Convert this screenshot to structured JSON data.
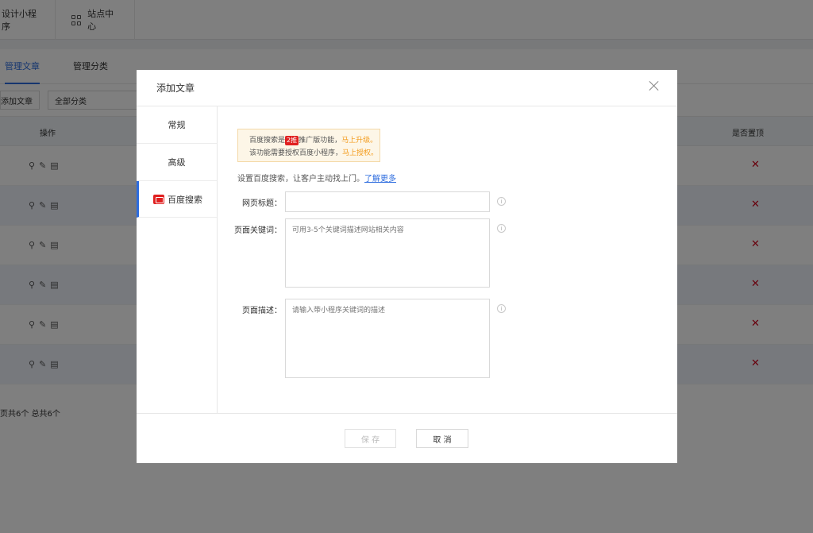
{
  "topbar": {
    "item1": "设计小程序",
    "item2": "站点中心"
  },
  "tabs": [
    "管理文章",
    "管理分类"
  ],
  "toolbar": {
    "add_label": "添加文章",
    "category_select": "全部分类"
  },
  "table": {
    "col_ops": "操作",
    "col_top": "是否置顶",
    "rows": 6,
    "x_mark": "✕"
  },
  "footer": "页共6个  总共6个",
  "modal": {
    "title": "添加文章",
    "side": {
      "item1": "常规",
      "item2": "高级",
      "item3": "百度搜索"
    },
    "notice": {
      "line1_a": "百度搜索是",
      "tag": "2推",
      "line1_b": "推广版功能，",
      "line1_link": "马上升级。",
      "line2_a": "该功能需要授权百度小程序，",
      "line2_link": "马上授权。"
    },
    "intro": "设置百度搜索，让客户主动找上门。",
    "intro_link": "了解更多",
    "fields": {
      "title_label": "网页标题：",
      "keywords_label": "页面关键词：",
      "keywords_placeholder": "可用3-5个关键词描述网站相关内容",
      "desc_label": "页面描述：",
      "desc_placeholder": "请输入带小程序关键词的描述"
    },
    "info_glyph": "i",
    "buttons": {
      "save": "保 存",
      "cancel": "取 消"
    }
  }
}
